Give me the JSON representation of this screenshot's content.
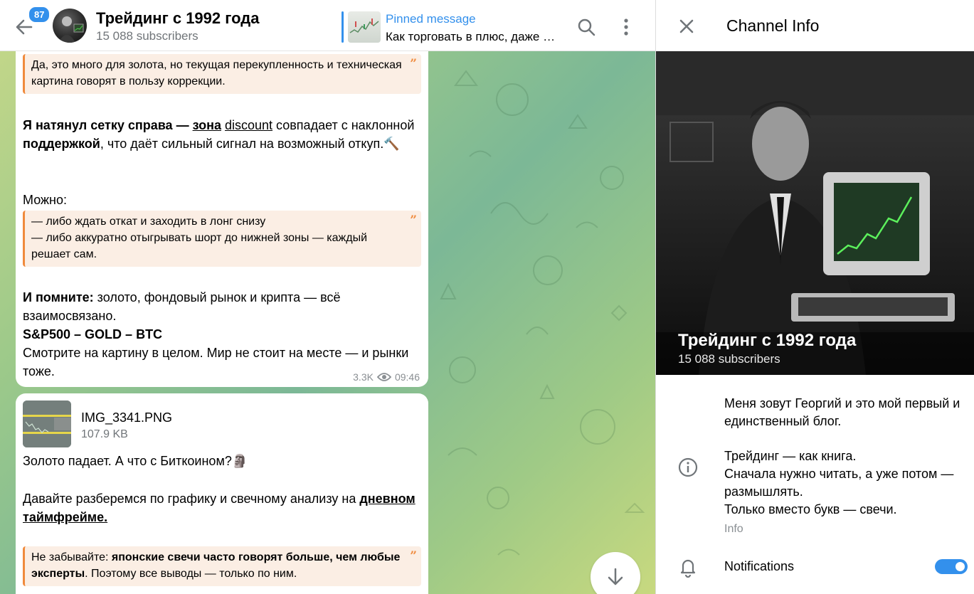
{
  "chat_header": {
    "unread_count": "87",
    "title": "Трейдинг с 1992 года",
    "subscribers": "15 088 subscribers",
    "pinned_label": "Pinned message",
    "pinned_text": "Как торговать в плюс, даже …"
  },
  "message1": {
    "quote1": "Да, это много для золота, но текущая перекупленность и техническая картина говорят в пользу коррекции.",
    "para1_bold": "Я натянул сетку справа — ",
    "para1_link1": "зона",
    "para1_link2": "discount",
    "para1_mid": " совпадает с наклонной ",
    "para1_bold2": "поддержкой",
    "para1_end": ", что даёт сильный сигнал на возможный откуп.🔨",
    "para2": "Можно:",
    "quote2_line1": "— либо ждать откат и заходить в лонг снизу",
    "quote2_line2": "— либо аккуратно отыгрывать шорт до нижней зоны — каждый решает сам.",
    "para3_bold": "И помните:",
    "para3_rest": " золото, фондовый рынок и крипта — всё взаимосвязано.",
    "para4": "S&P500 – GOLD – BTC",
    "para5": "Смотрите на картину в целом. Мир не стоит на месте — и рынки тоже.",
    "views": "3.3K",
    "time": "09:46"
  },
  "message2": {
    "file_name": "IMG_3341.PNG",
    "file_size": "107.9 KB",
    "para1": "Золото падает. А что с Биткоином?🗿",
    "para2_start": "Давайте разберемся по графику и свечному анализу на ",
    "para2_link": "дневном таймфрейме.",
    "quote_start": "Не забывайте: ",
    "quote_bold": "японские свечи часто говорят больше, чем любые эксперты",
    "quote_end": ". Поэтому все выводы — только по ним."
  },
  "info_panel": {
    "title": "Channel Info",
    "channel_name": "Трейдинг с 1992 года",
    "subscribers": "15 088 subscribers",
    "desc1": "Меня зовут Георгий и это мой первый и единственный блог.",
    "desc2_line1": "Трейдинг — как книга.",
    "desc2_line2": "Сначала нужно читать, а уже потом — размышлять.",
    "desc2_line3": "Только вместо букв — свечи.",
    "desc_caption": "Info",
    "notifications_label": "Notifications",
    "notifications_on": true
  },
  "colors": {
    "accent": "#3390ec",
    "quote_border": "#f08a3c",
    "quote_bg": "#fbeee4"
  },
  "icons": [
    "back-arrow-icon",
    "search-icon",
    "more-vertical-icon",
    "close-icon",
    "info-icon",
    "bell-icon",
    "arrow-down-icon",
    "eye-icon",
    "quote-icon"
  ]
}
